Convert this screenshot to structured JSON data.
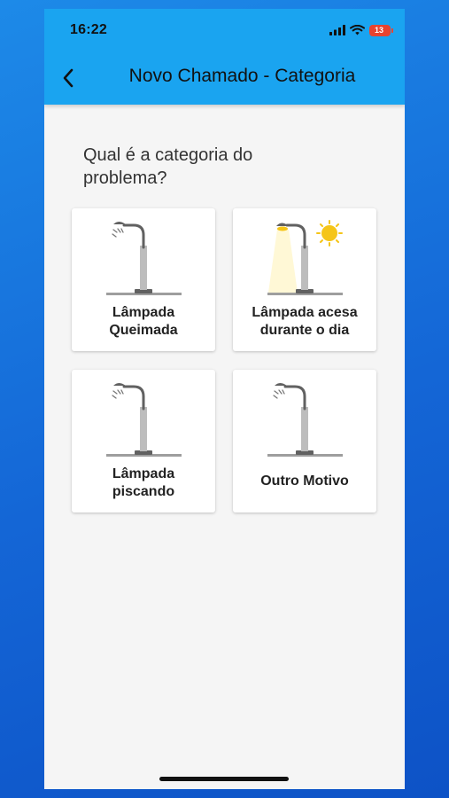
{
  "status_bar": {
    "time": "16:22",
    "battery": "13"
  },
  "header": {
    "title": "Novo Chamado - Categoria",
    "back_icon": "chevron-left-icon"
  },
  "question": "Qual é a categoria do problema?",
  "categories": [
    {
      "label": "Lâmpada\nQueimada",
      "icon": "streetlight-off-icon"
    },
    {
      "label": "Lâmpada acesa\ndurante o dia",
      "icon": "streetlight-day-on-icon"
    },
    {
      "label": "Lâmpada\npiscando",
      "icon": "streetlight-blinking-icon"
    },
    {
      "label": "Outro Motivo",
      "icon": "streetlight-other-icon"
    }
  ],
  "colors": {
    "app_bar": "#1aa4f0",
    "background": "#f5f5f5",
    "battery_low": "#e8432f",
    "sun": "#f5c518"
  }
}
